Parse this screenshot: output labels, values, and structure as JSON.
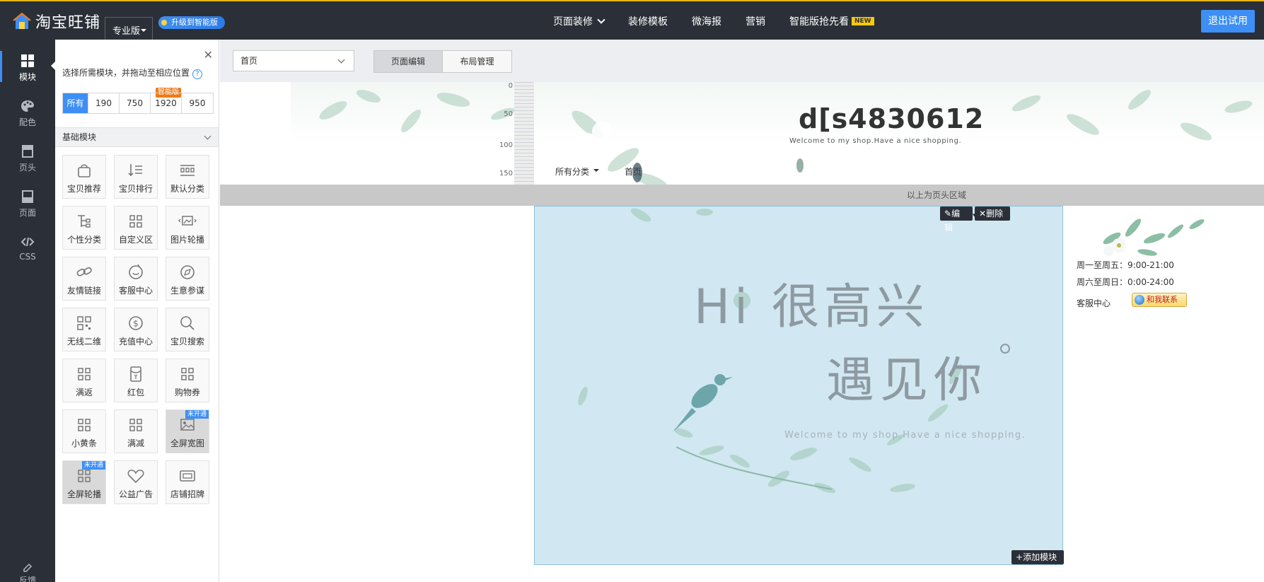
{
  "topbar": {
    "logo_text": "淘宝旺铺",
    "edition": "专业版",
    "upgrade": "升级到智能版",
    "nav": [
      {
        "label": "页面装修",
        "has_dropdown": true
      },
      {
        "label": "装修模板"
      },
      {
        "label": "微海报"
      },
      {
        "label": "营销"
      },
      {
        "label": "智能版抢先看",
        "badge": "NEW"
      }
    ],
    "exit_label": "退出试用"
  },
  "rail": {
    "items": [
      {
        "label": "模块",
        "icon": "grid-icon",
        "active": true
      },
      {
        "label": "配色",
        "icon": "palette-icon"
      },
      {
        "label": "页头",
        "icon": "page-header-icon"
      },
      {
        "label": "页面",
        "icon": "page-icon"
      },
      {
        "label": "CSS",
        "icon": "code-icon"
      }
    ],
    "feedback": "反馈"
  },
  "panel": {
    "hint": "选择所需模块，并拖动至相应位置",
    "size_tabs": [
      "所有",
      "190",
      "750",
      "1920",
      "950"
    ],
    "smart_badge": "智能版",
    "section_title": "基础模块",
    "modules": [
      {
        "label": "宝贝推荐",
        "icon": "bag-icon"
      },
      {
        "label": "宝贝排行",
        "icon": "sort-list-icon"
      },
      {
        "label": "默认分类",
        "icon": "category-icon"
      },
      {
        "label": "个性分类",
        "icon": "tree-icon"
      },
      {
        "label": "自定义区",
        "icon": "grid-icon"
      },
      {
        "label": "图片轮播",
        "icon": "carousel-icon"
      },
      {
        "label": "友情链接",
        "icon": "link-icon"
      },
      {
        "label": "客服中心",
        "icon": "service-icon"
      },
      {
        "label": "生意参谋",
        "icon": "compass-icon"
      },
      {
        "label": "无线二维",
        "icon": "qrcode-icon"
      },
      {
        "label": "充值中心",
        "icon": "dollar-icon"
      },
      {
        "label": "宝贝搜索",
        "icon": "search-icon"
      },
      {
        "label": "满返",
        "icon": "grid-icon"
      },
      {
        "label": "红包",
        "icon": "red-packet-icon"
      },
      {
        "label": "购物券",
        "icon": "grid-icon"
      },
      {
        "label": "小黄条",
        "icon": "grid-icon"
      },
      {
        "label": "满减",
        "icon": "grid-icon"
      },
      {
        "label": "全屏宽图",
        "icon": "image-icon",
        "flag": "未开通"
      },
      {
        "label": "全屏轮播",
        "icon": "grid-icon",
        "flag": "未开通"
      },
      {
        "label": "公益广告",
        "icon": "heart-icon"
      },
      {
        "label": "店铺招牌",
        "icon": "signboard-icon"
      }
    ]
  },
  "toolbar": {
    "page_select": "首页",
    "modes": [
      "页面编辑",
      "布局管理"
    ]
  },
  "canvas": {
    "ruler_marks": [
      "0",
      "50",
      "100",
      "150"
    ],
    "shop_name": "d[s4830612",
    "shop_slogan": "Welcome to my shop.Have a nice shopping.",
    "nav_category": "所有分类",
    "nav_home": "首页",
    "header_divider": "以上为页头区域",
    "banner": {
      "line1": "Hi  很高兴",
      "line2": "遇见你",
      "welcome": "Welcome to my shop.Have a nice shopping."
    },
    "block_actions": {
      "edit": "编辑",
      "delete": "删除",
      "add": "添加模块"
    },
    "side": {
      "hours_weekday": "周一至周五：9:00-21:00",
      "hours_weekend": "周六至周日：0:00-24:00",
      "service_label": "客服中心",
      "contact_button": "和我联系"
    }
  },
  "colors": {
    "topbar_bg": "#2b3038",
    "accent": "#3d8ff5",
    "banner_bg": "#d1e7f1"
  }
}
